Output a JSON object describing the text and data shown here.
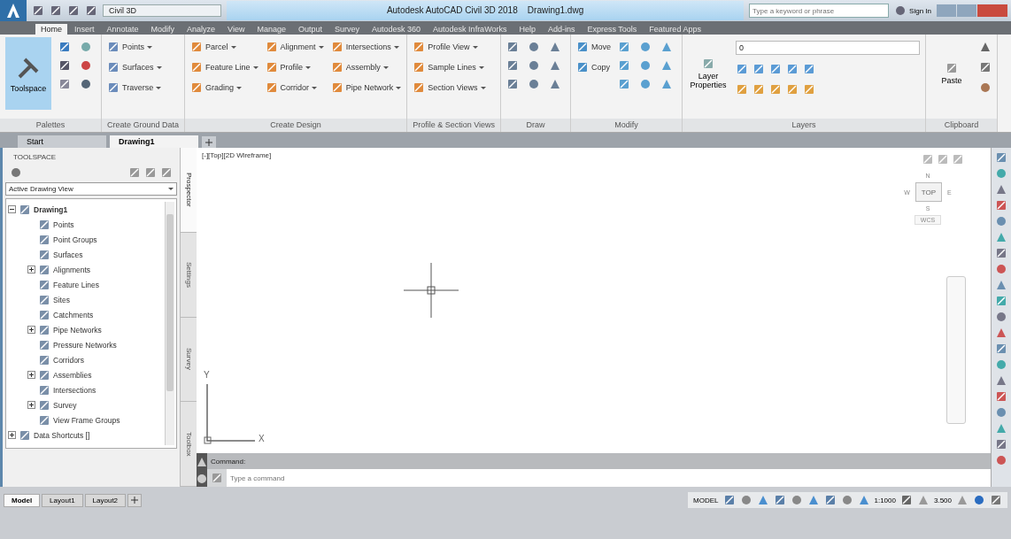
{
  "title_bar": {
    "workspace": "Civil 3D",
    "title": "Autodesk AutoCAD Civil 3D 2018    Drawing1.dwg",
    "search": {
      "placeholder": "Type a keyword or phrase"
    },
    "sign_in": "Sign In"
  },
  "ribbon_tabs": [
    {
      "label": "Home",
      "selected": true
    },
    {
      "label": "Insert",
      "selected": false
    },
    {
      "label": "Annotate",
      "selected": false
    },
    {
      "label": "Modify",
      "selected": false
    },
    {
      "label": "Analyze",
      "selected": false
    },
    {
      "label": "View",
      "selected": false
    },
    {
      "label": "Manage",
      "selected": false
    },
    {
      "label": "Output",
      "selected": false
    },
    {
      "label": "Survey",
      "selected": false
    },
    {
      "label": "Autodesk 360",
      "selected": false
    },
    {
      "label": "Autodesk InfraWorks",
      "selected": false
    },
    {
      "label": "Help",
      "selected": false
    },
    {
      "label": "Add-ins",
      "selected": false
    },
    {
      "label": "Express Tools",
      "selected": false
    },
    {
      "label": "Featured Apps",
      "selected": false
    }
  ],
  "ribbon_panels": [
    {
      "label": "Palettes",
      "kind": "palettes",
      "big_button": "Toolspace"
    },
    {
      "label": "Create Ground Data",
      "kind": "columns",
      "columns": [
        [
          "Points",
          "Surfaces",
          "Traverse"
        ]
      ]
    },
    {
      "label": "Create Design",
      "kind": "columns",
      "columns": [
        [
          "Parcel",
          "Feature Line",
          "Grading"
        ],
        [
          "Alignment",
          "Profile",
          "Corridor"
        ],
        [
          "Intersections",
          "Assembly",
          "Pipe Network"
        ]
      ]
    },
    {
      "label": "Profile & Section Views",
      "kind": "columns",
      "columns": [
        [
          "Profile View",
          "Sample Lines",
          "Section Views"
        ]
      ]
    },
    {
      "label": "Draw",
      "kind": "icons"
    },
    {
      "label": "Modify",
      "kind": "modify",
      "items": [
        "Move",
        "Copy"
      ]
    },
    {
      "label": "Layers",
      "kind": "layers",
      "big_button": "Layer Properties",
      "layer": "0"
    },
    {
      "label": "Clipboard",
      "kind": "clipboard",
      "big_button": "Paste"
    }
  ],
  "doc_tabs": [
    {
      "label": "Start",
      "selected": false
    },
    {
      "label": "Drawing1",
      "selected": true
    }
  ],
  "toolspace": {
    "title": "TOOLSPACE",
    "view": "Active Drawing View",
    "tree": [
      {
        "label": "Drawing1",
        "expanded": true,
        "children": [
          {
            "label": "Points"
          },
          {
            "label": "Point Groups"
          },
          {
            "label": "Surfaces"
          },
          {
            "label": "Alignments",
            "expanded": false
          },
          {
            "label": "Feature Lines"
          },
          {
            "label": "Sites"
          },
          {
            "label": "Catchments"
          },
          {
            "label": "Pipe Networks",
            "expanded": false
          },
          {
            "label": "Pressure Networks"
          },
          {
            "label": "Corridors"
          },
          {
            "label": "Assemblies",
            "expanded": false
          },
          {
            "label": "Intersections"
          },
          {
            "label": "Survey",
            "expanded": false
          },
          {
            "label": "View Frame Groups"
          }
        ]
      },
      {
        "label": "Data Shortcuts []",
        "expanded": false
      }
    ]
  },
  "side_tabs": [
    {
      "label": "Prospector",
      "selected": true
    },
    {
      "label": "Settings",
      "selected": false
    },
    {
      "label": "Survey",
      "selected": false
    },
    {
      "label": "Toolbox",
      "selected": false
    }
  ],
  "viewport": {
    "label": "[-][Top][2D Wireframe]",
    "viewcube": {
      "top": "TOP",
      "north": "N",
      "south": "S",
      "east": "E",
      "west": "W",
      "ucs": "WCS"
    },
    "ucs": {
      "x": "X",
      "y": "Y"
    }
  },
  "command": {
    "history": "Command:",
    "placeholder": "Type a command"
  },
  "layout_tabs": [
    {
      "label": "Model",
      "selected": true
    },
    {
      "label": "Layout1",
      "selected": false
    },
    {
      "label": "Layout2",
      "selected": false
    }
  ],
  "status_bar": {
    "mode": "MODEL",
    "scale": "1:1000",
    "value": "3.500"
  }
}
